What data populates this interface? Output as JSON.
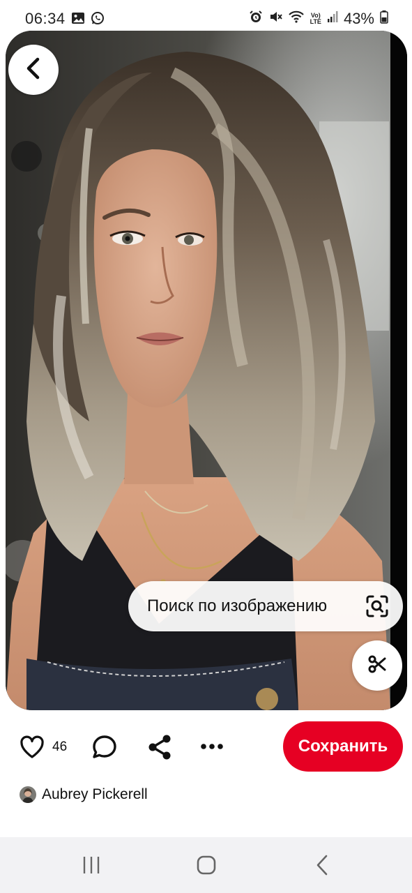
{
  "status_bar": {
    "time": "06:34",
    "left_icons": [
      "gallery-icon",
      "whatsapp-icon"
    ],
    "right_icons": [
      "alarm-icon",
      "mute-icon",
      "wifi-icon",
      "volte-icon",
      "signal-icon",
      "battery-icon"
    ],
    "volte_text_top": "Vo)",
    "volte_text_bottom": "LTE",
    "battery_percent": "43%"
  },
  "pin": {
    "image_description_icon": "portrait-photo",
    "visual_search_label": "Поиск по изображению",
    "visual_search_icon": "lens-search-icon",
    "crop_icon": "scissors-icon"
  },
  "actions": {
    "like_count": "46",
    "save_label": "Сохранить",
    "save_color": "#e60023"
  },
  "author": {
    "name": "Aubrey Pickerell"
  }
}
